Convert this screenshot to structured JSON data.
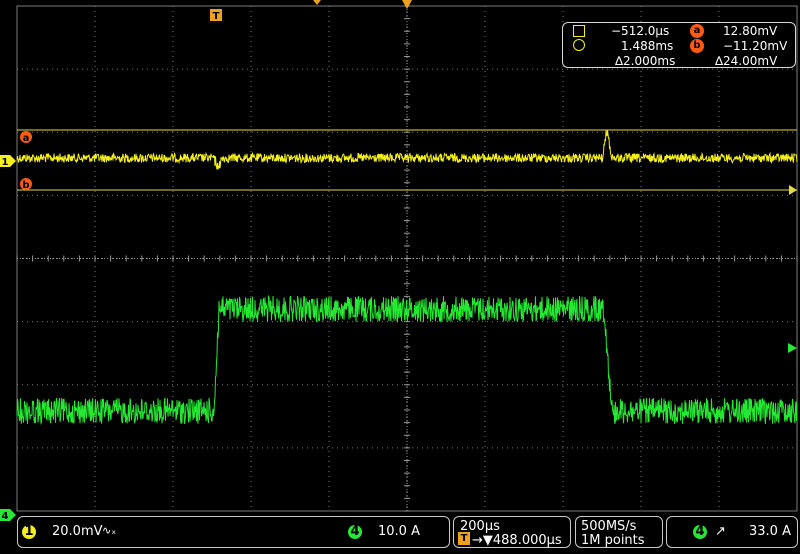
{
  "colors": {
    "ch1": "#f6f01a",
    "ch4": "#25e832",
    "grid": "#8a8a8a",
    "cursor": "#f6f01a",
    "marker_orange": "#ff5a12",
    "border": "#c9c9c9"
  },
  "icons": {
    "trigger_pos": "trigger-position-icon",
    "trigger_level": "trigger-level-icon",
    "cursor_a": "cursor-a-icon",
    "cursor_b": "cursor-b-icon",
    "square": "square-icon",
    "circle": "circle-icon"
  },
  "top_markers": {
    "trigger_label": "T"
  },
  "channel_markers": {
    "ch1": "1",
    "ch4": "4",
    "cursor_a": "a",
    "cursor_b": "b"
  },
  "cursor_readout": {
    "t1": "−512.0µs",
    "t2": "1.488ms",
    "delta_t": "∆2.000ms",
    "va": "12.80mV",
    "vb": "−11.20mV",
    "delta_v": "∆24.00mV",
    "label_a": "a",
    "label_b": "b"
  },
  "status_bar": {
    "ch1_num": "1",
    "ch1_scale": "20.0mV",
    "ch1_coupling": "∿ₓ",
    "ch4_num": "4",
    "ch4_scale": "10.0 A",
    "timebase": "200µs",
    "trigger_prefix": "T",
    "trigger_position": "→▼488.000µs",
    "sample_rate": "500MS/s",
    "record_length": "1M points",
    "trig_source": "4",
    "trig_slope": "↗",
    "trig_level": "33.0 A"
  }
}
